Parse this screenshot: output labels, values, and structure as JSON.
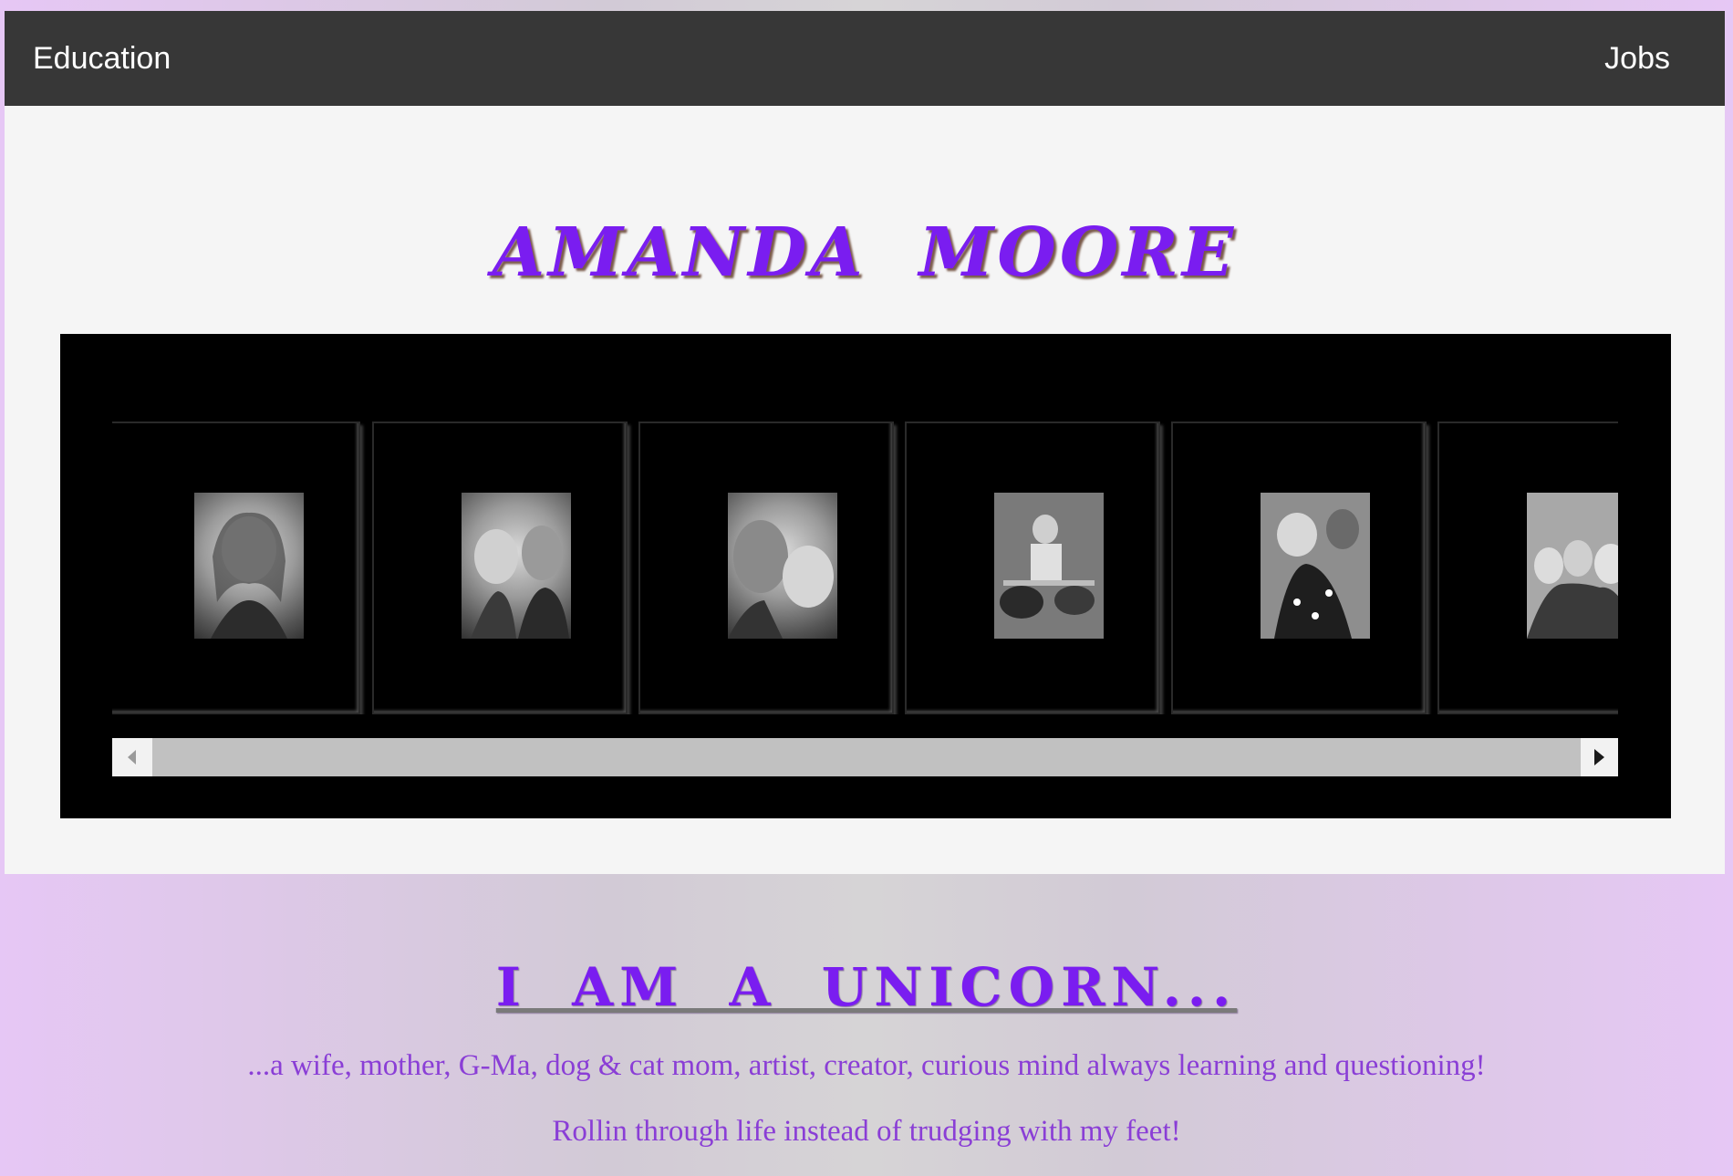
{
  "nav": {
    "left_label": "Education",
    "right_label": "Jobs"
  },
  "hero": {
    "name": "AMANDA  MOORE"
  },
  "gallery": {
    "photos": [
      {
        "icon": "portrait-photo"
      },
      {
        "icon": "couple-photo"
      },
      {
        "icon": "selfie-photo"
      },
      {
        "icon": "drummer-photo"
      },
      {
        "icon": "child-photo"
      },
      {
        "icon": "group-photo"
      }
    ]
  },
  "about": {
    "heading": "I AM A UNICORN...",
    "line1": "...a wife, mother, G-Ma, dog & cat mom, artist, creator, curious mind always learning and questioning!",
    "line2": "Rollin through life instead of trudging with my feet!"
  },
  "colors": {
    "accent": "#7a1df0",
    "navbar": "#373737",
    "tagline": "#8a3ed6"
  }
}
